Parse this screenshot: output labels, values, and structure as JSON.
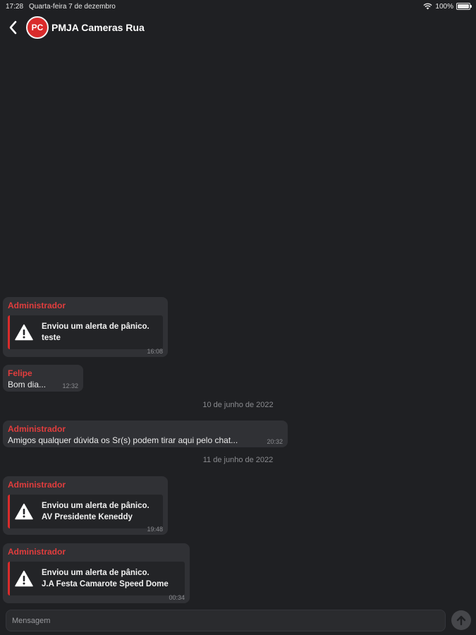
{
  "status_bar": {
    "time": "17:28",
    "date": "Quarta-feira 7 de dezembro",
    "battery": "100%",
    "battery_level": 1.0
  },
  "header": {
    "avatar_initials": "PC",
    "title": "PMJA Cameras Rua"
  },
  "messages": [
    {
      "sender": "Administrador",
      "alert_line1": "Enviou um alerta de pânico.",
      "alert_line2": "teste",
      "time": "16:08"
    },
    {
      "sender": "Felipe",
      "text": "Bom dia...",
      "time": "12:32"
    },
    {
      "sender": "Administrador",
      "text": "Amigos qualquer dúvida os Sr(s) podem tirar aqui pelo chat...",
      "time": "20:32"
    },
    {
      "sender": "Administrador",
      "alert_line1": "Enviou um alerta de pânico.",
      "alert_line2": "AV Presidente Keneddy",
      "time": "19:48"
    },
    {
      "sender": "Administrador",
      "alert_line1": "Enviou um alerta de pânico.",
      "alert_line2": "J.A Festa Camarote Speed Dome",
      "time": "00:34"
    }
  ],
  "date_separators": [
    "10 de junho de 2022",
    "11 de junho de 2022"
  ],
  "composer": {
    "placeholder": "Mensagem"
  },
  "colors": {
    "background": "#1f2023",
    "bubble": "#303135",
    "accent_red": "#d92b2b",
    "sender_red": "#e23d3d"
  },
  "icons": {
    "back": "chevron-left-icon",
    "alert": "warning-triangle-icon",
    "send": "arrow-up-icon",
    "wifi": "wifi-icon",
    "battery": "battery-icon"
  }
}
